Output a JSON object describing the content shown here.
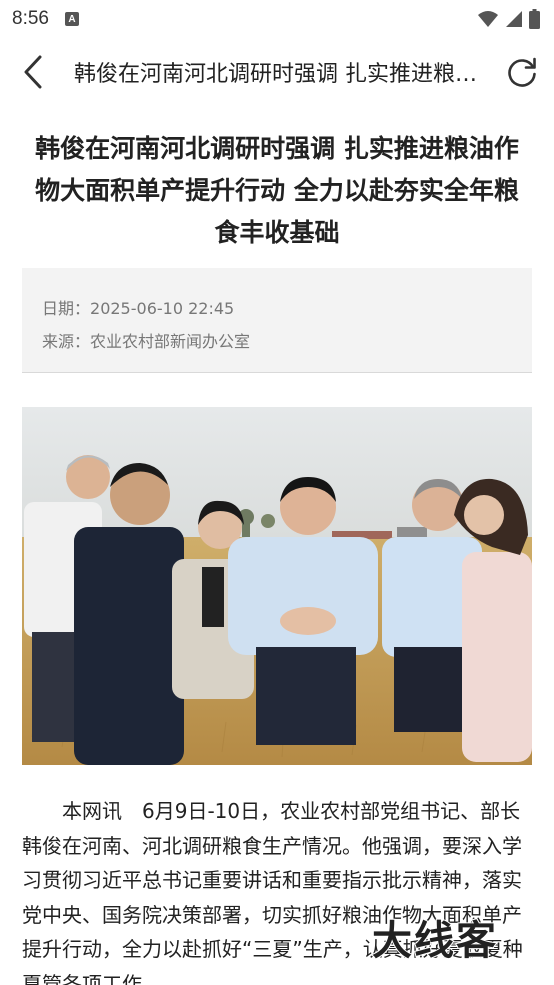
{
  "status_bar": {
    "time": "8:56",
    "notification_icon": "a-letter-icon",
    "wifi_icon": "wifi-icon",
    "signal_icon": "cell-signal-icon",
    "battery_icon": "battery-icon"
  },
  "nav": {
    "back_icon": "chevron-left-icon",
    "title": "韩俊在河南河北调研时强调 扎实推进粮油作物大面积单产提升行动 全力以赴夯实全年粮食丰收基础",
    "refresh_icon": "refresh-icon"
  },
  "article": {
    "title": "韩俊在河南河北调研时强调 扎实推进粮油作物大面积单产提升行动 全力以赴夯实全年粮食丰收基础",
    "date_label": "日期：",
    "date": "2025-06-10 22:45",
    "source_label": "来源：",
    "source": "农业农村部新闻办公室",
    "body": "本网讯　6月9日-10日，农业农村部党组书记、部长韩俊在河南、河北调研粮食生产情况。他强调，要深入学习贯彻习近平总书记重要讲话和重要指示批示精神，落实党中央、国务院决策部署，切实抓好粮油作物大面积单产提升行动，全力以赴抓好“三夏”生产，认真抓好夏收夏种夏管各项工作。"
  },
  "watermark": {
    "text": "大线客"
  },
  "colors": {
    "background": "#ffffff",
    "meta_bg": "#f3f3f3",
    "meta_text": "#777777",
    "text": "#222222",
    "sky": "#dfe3e5",
    "wheat": "#c9a45e"
  }
}
